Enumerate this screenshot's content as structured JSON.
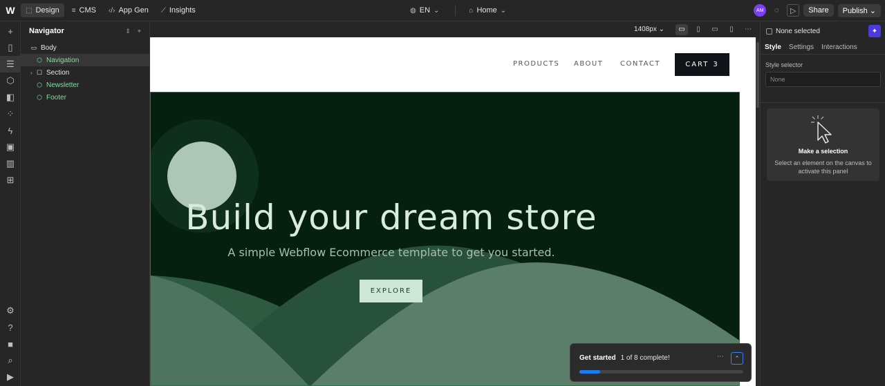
{
  "topbar": {
    "logo": "W",
    "nav": [
      {
        "label": "Design",
        "icon": "design-icon"
      },
      {
        "label": "CMS",
        "icon": "database-icon"
      },
      {
        "label": "App Gen",
        "icon": "code-icon"
      },
      {
        "label": "Insights",
        "icon": "chart-icon"
      }
    ],
    "locale": "EN",
    "page": "Home",
    "avatar": "AM",
    "share_label": "Share",
    "publish_label": "Publish"
  },
  "navigator": {
    "title": "Navigator",
    "items": [
      {
        "label": "Body"
      },
      {
        "label": "Navigation"
      },
      {
        "label": "Section"
      },
      {
        "label": "Newsletter"
      },
      {
        "label": "Footer"
      }
    ]
  },
  "canvas": {
    "width_label": "1408px"
  },
  "site": {
    "nav_links": [
      "PRODUCTS",
      "ABOUT",
      "CONTACT"
    ],
    "cart_label": "CART",
    "cart_count": "3",
    "hero_title": "Build your dream store",
    "hero_subtitle": "A simple Webflow Ecommerce template to get you started.",
    "hero_button": "EXPLORE",
    "colors": {
      "hero_bg": "#05200f",
      "hills": "#3f6750",
      "accent_button": "#cde6d6"
    }
  },
  "get_started": {
    "title": "Get started",
    "progress_text": "1 of 8 complete!",
    "progress": 0.125
  },
  "right_panel": {
    "selection": "None selected",
    "tabs": [
      "Style",
      "Settings",
      "Interactions"
    ],
    "selector_label": "Style selector",
    "selector_value": "None",
    "empty_title": "Make a selection",
    "empty_text": "Select an element on the canvas to activate this panel"
  }
}
